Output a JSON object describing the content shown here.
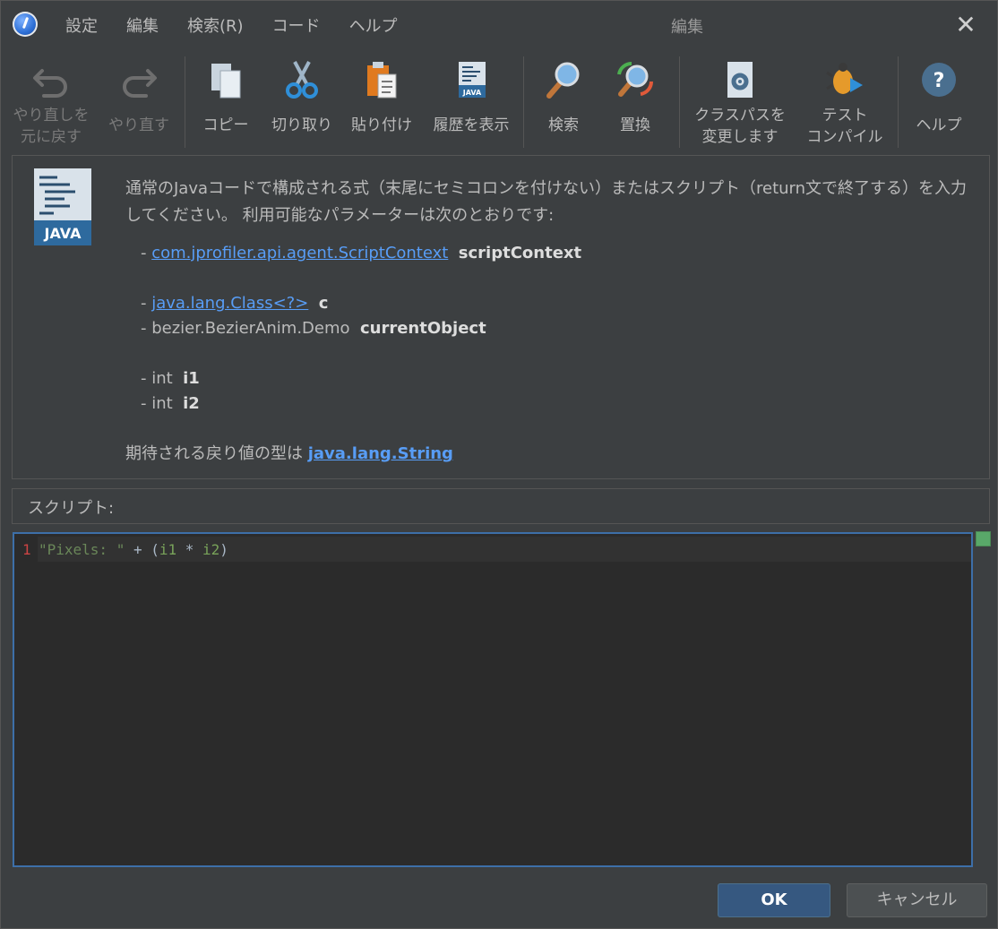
{
  "menu": [
    "設定",
    "編集",
    "検索(R)",
    "コード",
    "ヘルプ"
  ],
  "window_title": "編集",
  "toolbar": {
    "undo": [
      "やり直しを",
      "元に戻す"
    ],
    "redo": "やり直す",
    "copy": "コピー",
    "cut": "切り取り",
    "paste": "貼り付け",
    "history": "履歴を表示",
    "find": "検索",
    "replace": "置換",
    "classpath": [
      "クラスパスを",
      "変更します"
    ],
    "test_compile": [
      "テスト",
      "コンパイル"
    ],
    "help": "ヘルプ"
  },
  "description": {
    "intro": "通常のJavaコードで構成される式（末尾にセミコロンを付けない）またはスクリプト（return文で終了する）を入力してください。 利用可能なパラメーターは次のとおりです:",
    "params": [
      {
        "type": "com.jprofiler.api.agent.ScriptContext",
        "type_link": true,
        "name": "scriptContext"
      },
      {
        "type": "java.lang.Class<?>",
        "type_link": true,
        "name": "c"
      },
      {
        "type": "bezier.BezierAnim.Demo",
        "type_link": false,
        "name": "currentObject"
      },
      {
        "type": "int",
        "type_link": false,
        "name": "i1"
      },
      {
        "type": "int",
        "type_link": false,
        "name": "i2"
      }
    ],
    "return_prefix": "期待される戻り値の型は",
    "return_type": "java.lang.String",
    "java_icon_text": "JAVA"
  },
  "script_label": "スクリプト:",
  "editor": {
    "line_number": "1",
    "code_string": "\"Pixels: \"",
    "code_op1": " + (",
    "code_var1": "i1",
    "code_op2": " * ",
    "code_var2": "i2",
    "code_close": ")"
  },
  "buttons": {
    "ok": "OK",
    "cancel": "キャンセル"
  },
  "colors": {
    "link": "#589df6",
    "accent": "#365880",
    "editor_border": "#3d6fa8"
  }
}
